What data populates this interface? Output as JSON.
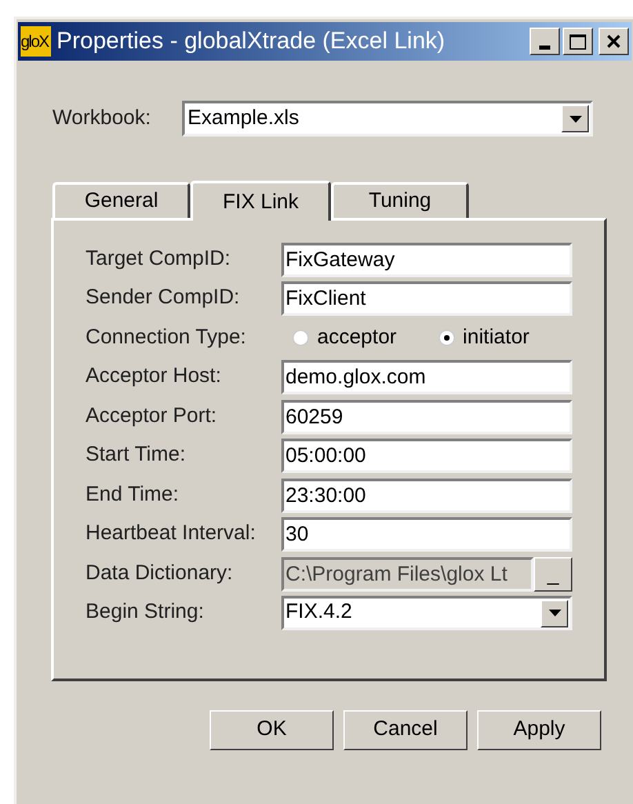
{
  "window": {
    "logo": "gloX",
    "title": "Properties - globalXtrade (Excel Link)"
  },
  "workbook": {
    "label": "Workbook:",
    "value": "Example.xls"
  },
  "tabs": [
    {
      "label": "General",
      "selected": false
    },
    {
      "label": "FIX Link",
      "selected": true
    },
    {
      "label": "Tuning",
      "selected": false
    }
  ],
  "fields": [
    {
      "kind": "text",
      "label": "Target CompID:",
      "value": "FixGateway"
    },
    {
      "kind": "text",
      "label": "Sender CompID:",
      "value": "FixClient"
    },
    {
      "kind": "radio",
      "label": "Connection Type:",
      "options": [
        {
          "label": "acceptor",
          "selected": false
        },
        {
          "label": "initiator",
          "selected": true
        }
      ]
    },
    {
      "kind": "text",
      "label": "Acceptor Host:",
      "value": "demo.glox.com"
    },
    {
      "kind": "text",
      "label": "Acceptor Port:",
      "value": "60259"
    },
    {
      "kind": "text",
      "label": "Start Time:",
      "value": "05:00:00"
    },
    {
      "kind": "text",
      "label": "End Time:",
      "value": "23:30:00"
    },
    {
      "kind": "text",
      "label": "Heartbeat Interval:",
      "value": "30"
    },
    {
      "kind": "file",
      "label": "Data Dictionary:",
      "value": "C:\\Program Files\\glox Lt",
      "disabled": true,
      "button": "_"
    },
    {
      "kind": "combo",
      "label": "Begin String:",
      "value": "FIX.4.2"
    }
  ],
  "buttons": [
    "OK",
    "Cancel",
    "Apply"
  ]
}
